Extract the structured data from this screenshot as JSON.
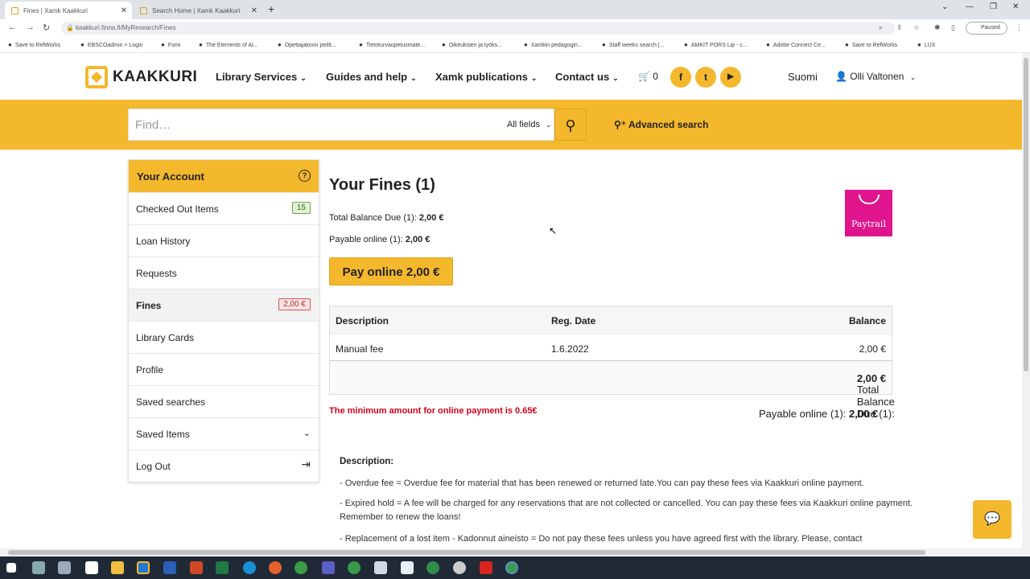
{
  "browser": {
    "tabs": [
      {
        "title": "Fines | Xamk Kaakkuri"
      },
      {
        "title": "Search Home | Xamk Kaakkuri"
      }
    ],
    "new_tab": "+",
    "url": "kaakkuri.finna.fi/MyResearch/Fines",
    "profile_label": "Paused",
    "bookmarks": [
      "Save to RefWorks",
      "EBSCOadmin > Login",
      "Fomi",
      "The Elements of AI...",
      "Opettajakoon peilit...",
      "Tietoturvaopetusmate...",
      "Oikeuksien ja työks...",
      "Xamkin pedagogin...",
      "Staff weeks search |...",
      "AMKIT PORS Lip - c...",
      "Adobe Connect Ce...",
      "Save to RefWorks",
      "LUX"
    ]
  },
  "header": {
    "logo_text": "KAAKKURI",
    "nav": [
      "Library Services",
      "Guides and help",
      "Xamk publications",
      "Contact us"
    ],
    "cart_count": "0",
    "social": [
      "f",
      "t",
      "▶"
    ],
    "language": "Suomi",
    "user_name": "Olli Valtonen"
  },
  "search": {
    "placeholder": "Find…",
    "field_select": "All fields",
    "advanced_label": "Advanced search"
  },
  "sidebar": {
    "title": "Your Account",
    "items": [
      {
        "label": "Checked Out Items",
        "badge": "15"
      },
      {
        "label": "Loan History"
      },
      {
        "label": "Requests"
      },
      {
        "label": "Fines",
        "badge": "2,00 €"
      },
      {
        "label": "Library Cards"
      },
      {
        "label": "Profile"
      },
      {
        "label": "Saved searches"
      },
      {
        "label": "Saved Items"
      },
      {
        "label": "Log Out"
      }
    ]
  },
  "main": {
    "title": "Your Fines (1)",
    "total_label": "Total Balance Due (1):",
    "total_value": "2,00 €",
    "payable_label": "Payable online (1):",
    "payable_value": "2,00 €",
    "pay_button": "Pay online 2,00 €",
    "paytrail_label": "Paytrail",
    "table": {
      "headers": [
        "Description",
        "Reg. Date",
        "Balance"
      ],
      "rows": [
        {
          "description": "Manual fee",
          "date": "1.6.2022",
          "balance": "2,00 €"
        }
      ],
      "total_label": "Total Balance Due (1):",
      "total_value": "2,00 €"
    },
    "warning": "The minimum amount for online payment is 0.65€",
    "payable_bottom_label": "Payable online (1):",
    "payable_bottom_value": "2,00 €",
    "description_title": "Description:",
    "description_lines": [
      "- Overdue fee = Overdue fee for material that has been renewed or returned late.You can pay these fees via Kaakkuri online payment.",
      "- Expired hold = A fee will be charged for any reservations that are not collected or cancelled. You can pay these fees via Kaakkuri online payment. Remember to renew the loans!",
      "- Replacement of a lost item - Kadonnut aineisto = Do not pay these fees unless you have agreed first with the library. Please, contact"
    ]
  },
  "colors": {
    "accent": "#f4b82d",
    "warning": "#d0021b",
    "paytrail": "#e0148c"
  }
}
